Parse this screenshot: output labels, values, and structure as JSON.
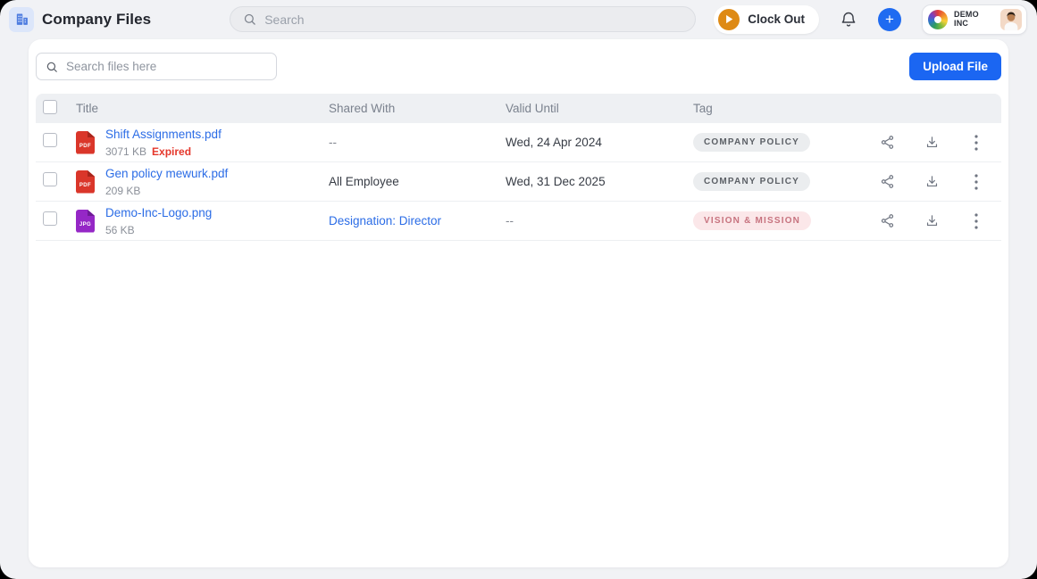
{
  "topbar": {
    "title": "Company Files",
    "search_placeholder": "Search",
    "clock_out_label": "Clock Out",
    "company": {
      "name_line1": "DEMO",
      "name_line2": "INC"
    }
  },
  "toolbar": {
    "search_placeholder": "Search files here",
    "upload_label": "Upload File"
  },
  "table": {
    "columns": [
      "Title",
      "Shared With",
      "Valid Until",
      "Tag"
    ],
    "rows": [
      {
        "file_type": "PDF",
        "name": "Shift Assignments.pdf",
        "size": "3071 KB",
        "status": "Expired",
        "shared_with": "--",
        "shared_with_is_link": false,
        "valid_until": "Wed, 24 Apr 2024",
        "tag": "COMPANY POLICY",
        "tag_style": "gray"
      },
      {
        "file_type": "PDF",
        "name": "Gen policy mewurk.pdf",
        "size": "209 KB",
        "status": "",
        "shared_with": "All Employee",
        "shared_with_is_link": false,
        "valid_until": "Wed, 31 Dec 2025",
        "tag": "COMPANY POLICY",
        "tag_style": "gray"
      },
      {
        "file_type": "JPG",
        "name": "Demo-Inc-Logo.png",
        "size": "56 KB",
        "status": "",
        "shared_with": "Designation: Director",
        "shared_with_is_link": true,
        "valid_until": "--",
        "tag": "VISION & MISSION",
        "tag_style": "rose"
      }
    ]
  },
  "colors": {
    "accent_blue": "#1b66f2",
    "link_blue": "#2b6ce6",
    "expired_red": "#e5372b",
    "pdf_icon_red": "#da362a",
    "jpg_icon_purple": "#9527c6",
    "clock_out_orange": "#de8a15",
    "tag_gray_bg": "#ebedef",
    "tag_gray_text": "#5c6066",
    "tag_rose_bg": "#fbe7e9",
    "tag_rose_text": "#c7737f"
  }
}
